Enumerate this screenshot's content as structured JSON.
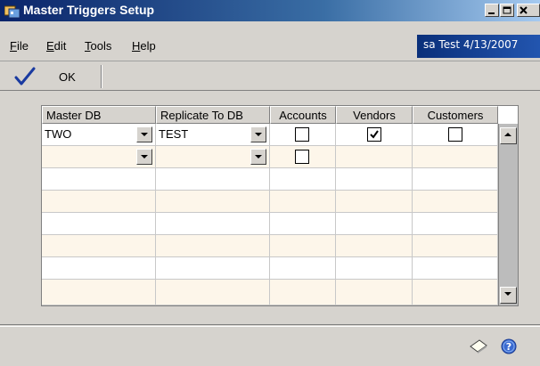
{
  "window": {
    "title": "Master Triggers Setup"
  },
  "menu": {
    "items": [
      {
        "label_ul": "F",
        "label_rest": "ile"
      },
      {
        "label_ul": "E",
        "label_rest": "dit"
      },
      {
        "label_ul": "T",
        "label_rest": "ools"
      },
      {
        "label_ul": "H",
        "label_rest": "elp"
      }
    ],
    "session": "sa  Test 4/13/2007"
  },
  "toolbar": {
    "ok_label": "OK"
  },
  "grid": {
    "columns": [
      "Master DB",
      "Replicate To DB",
      "Accounts",
      "Vendors",
      "Customers"
    ],
    "rows": [
      {
        "master_db": "TWO",
        "replicate_to_db": "TEST",
        "accounts": false,
        "vendors": true,
        "customers": false
      },
      {
        "master_db": "",
        "replicate_to_db": "",
        "accounts": false,
        "vendors": null,
        "customers": null
      }
    ],
    "empty_rows": 6
  },
  "icons": {
    "app": "window-app-icon",
    "ok": "checkmark-icon",
    "note": "note-icon",
    "help": "help-icon"
  },
  "colors": {
    "title_bar": "#0a246a",
    "session_panel": "#1a4a9a",
    "row_alt": "#fdf6ea",
    "window_bg": "#d6d3ce"
  }
}
